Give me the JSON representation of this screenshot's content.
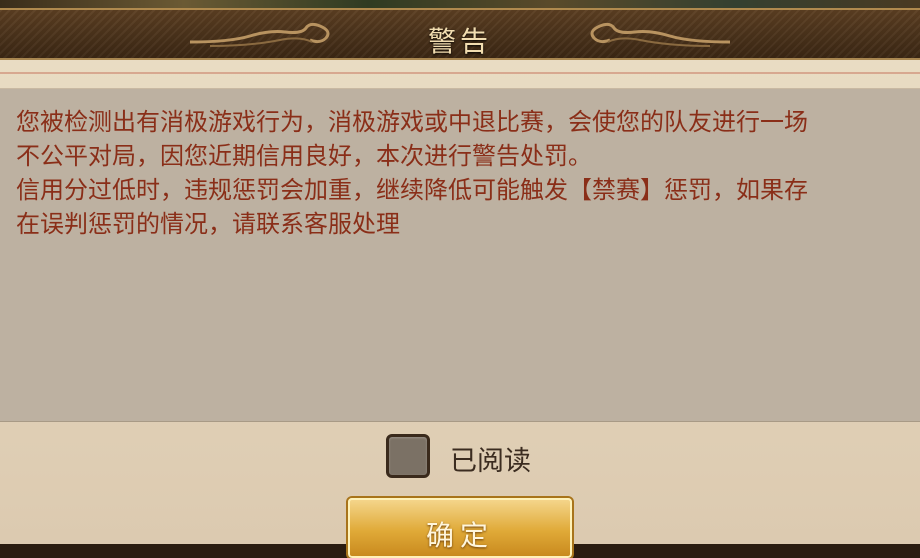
{
  "dialog": {
    "title": "警告",
    "message_lines": [
      "您被检测出有消极游戏行为，消极游戏或中退比赛，会使您的队友进行一场",
      "不公平对局，因您近期信用良好，本次进行警告处罚。",
      "信用分过低时，违规惩罚会加重，继续降低可能触发【禁赛】惩罚，如果存",
      "在误判惩罚的情况，请联系客服处理"
    ],
    "read_checkbox": {
      "label": "已阅读",
      "checked": false
    },
    "confirm_button": {
      "label": "确定"
    }
  },
  "colors": {
    "message_text": "#8a2e18",
    "title_text": "#f2ddb0",
    "panel_background": "#e9dcc3",
    "message_box_background": "#bdb1a1",
    "button_gold": "#e0aa38"
  }
}
